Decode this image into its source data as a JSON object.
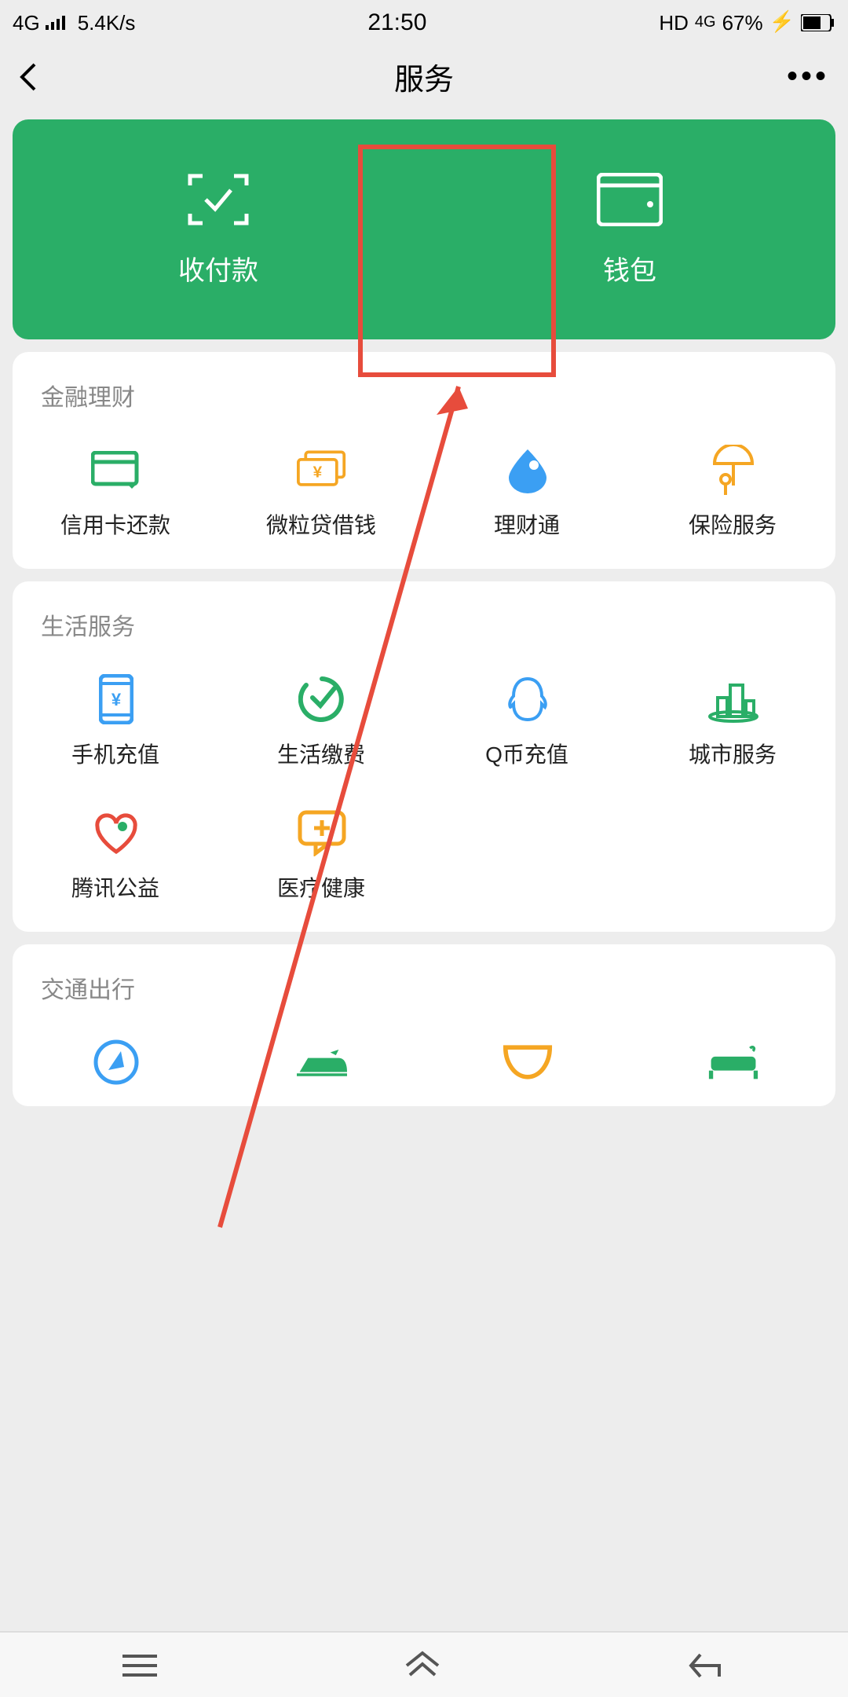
{
  "status": {
    "network": "4G",
    "speed": "5.4K/s",
    "time": "21:50",
    "hd": "HD",
    "signal4g": "4G",
    "battery": "67%"
  },
  "nav": {
    "title": "服务"
  },
  "hero": {
    "pay_label": "收付款",
    "wallet_label": "钱包"
  },
  "sections": {
    "finance": {
      "title": "金融理财",
      "items": [
        {
          "label": "信用卡还款"
        },
        {
          "label": "微粒贷借钱"
        },
        {
          "label": "理财通"
        },
        {
          "label": "保险服务"
        }
      ]
    },
    "life": {
      "title": "生活服务",
      "items": [
        {
          "label": "手机充值"
        },
        {
          "label": "生活缴费"
        },
        {
          "label": "Q币充值"
        },
        {
          "label": "城市服务"
        },
        {
          "label": "腾讯公益"
        },
        {
          "label": "医疗健康"
        }
      ]
    },
    "transport": {
      "title": "交通出行"
    }
  },
  "colors": {
    "primary_green": "#2aae67",
    "blue": "#3b9ff3",
    "orange": "#f5a623",
    "red": "#e74c3c"
  },
  "annotation": {
    "highlight_target": "wallet"
  }
}
